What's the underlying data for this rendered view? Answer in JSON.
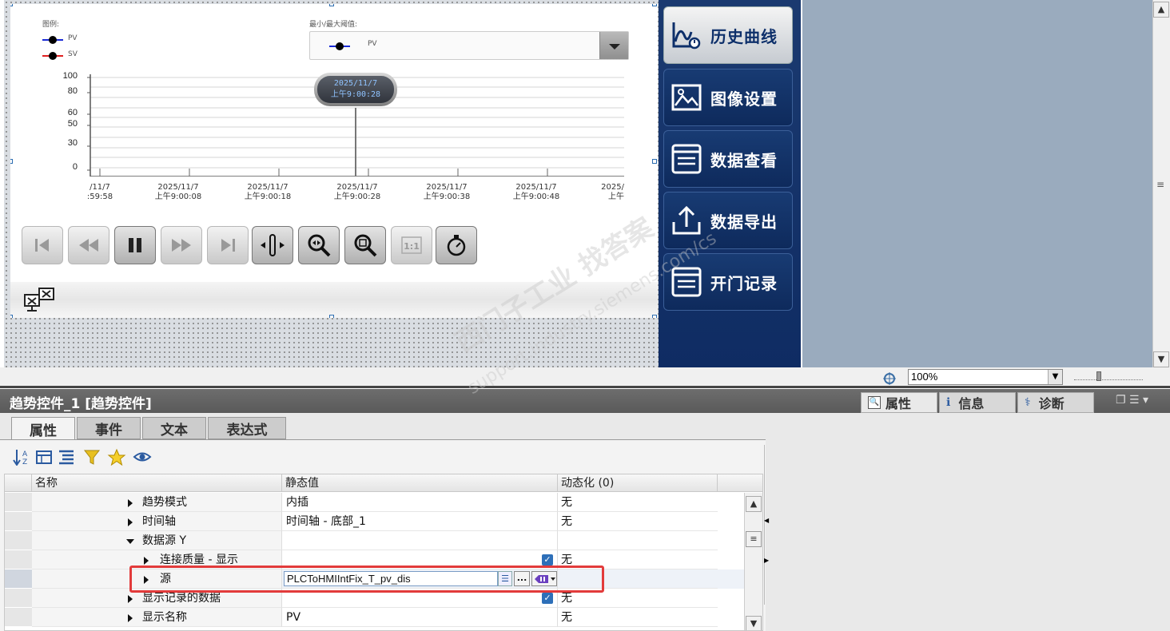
{
  "trend": {
    "legend_title": "图例:",
    "legend": [
      {
        "name": "PV",
        "color": "#1a2ad6"
      },
      {
        "name": "SV",
        "color": "#e02020"
      }
    ],
    "minmax_title": "最小/最大阈值:",
    "minmax_selected": "PV",
    "y_ticks": [
      "100",
      "80",
      "60",
      "50",
      "30",
      "0"
    ],
    "x_ticks": [
      {
        "date": "/11/7",
        "time": ":59:58"
      },
      {
        "date": "2025/11/7",
        "time": "上午9:00:08"
      },
      {
        "date": "2025/11/7",
        "time": "上午9:00:18"
      },
      {
        "date": "2025/11/7",
        "time": "上午9:00:28"
      },
      {
        "date": "2025/11/7",
        "time": "上午9:00:38"
      },
      {
        "date": "2025/11/7",
        "time": "上午9:00:48"
      },
      {
        "date": "2025/",
        "time": "上午"
      }
    ],
    "cursor_date": "2025/11/7",
    "cursor_time": "上午9:00:28"
  },
  "nav": {
    "buttons": [
      "历史曲线",
      "图像设置",
      "数据查看",
      "数据导出",
      "开门记录"
    ]
  },
  "zoom": {
    "value": "100%"
  },
  "inspector": {
    "title": "趋势控件_1 [趋势控件]",
    "right_tabs": [
      "属性",
      "信息",
      "诊断"
    ],
    "tabs": [
      "属性",
      "事件",
      "文本",
      "表达式"
    ],
    "columns": [
      "名称",
      "静态值",
      "动态化 (0)"
    ],
    "rows": [
      {
        "name": "趋势模式",
        "value": "内插",
        "dyn": "无"
      },
      {
        "name": "时间轴",
        "value": "时间轴 - 底部_1",
        "dyn": "无"
      },
      {
        "name": "数据源 Y",
        "value": "",
        "dyn": ""
      },
      {
        "name": "连接质量 - 显示",
        "value": "",
        "dyn": "无"
      },
      {
        "name": "源",
        "value": "PLCToHMIIntFix_T_pv_dis",
        "dyn": ""
      },
      {
        "name": "显示记录的数据",
        "value": "",
        "dyn": "无"
      },
      {
        "name": "显示名称",
        "value": "PV",
        "dyn": "无"
      }
    ]
  },
  "watermark": {
    "line1": "西门子工业 找答案",
    "line2": "support.industry.siemens.com/cs"
  },
  "colors": {
    "nav_bg": "#0f2c63",
    "highlight": "#e23b3b",
    "side_panel": "#9aabbe"
  }
}
